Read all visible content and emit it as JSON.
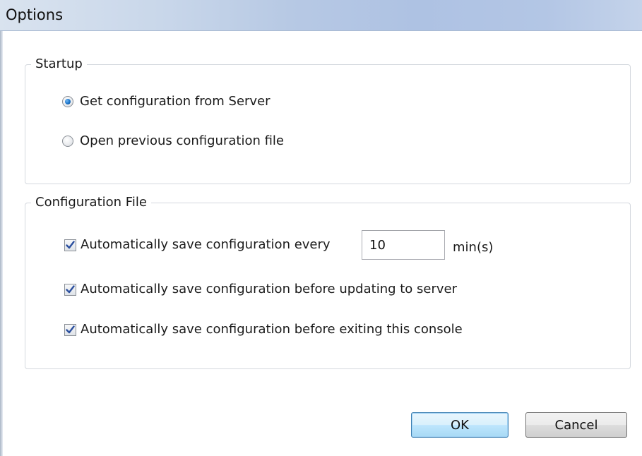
{
  "window": {
    "title": "Options"
  },
  "startup": {
    "legend": "Startup",
    "options": [
      {
        "label": "Get configuration from Server",
        "selected": true
      },
      {
        "label": "Open previous configuration file",
        "selected": false
      }
    ]
  },
  "config_file": {
    "legend": "Configuration File",
    "auto_save_every": {
      "label": "Automatically save configuration every",
      "checked": true,
      "minutes_value": "10",
      "unit": "min(s)"
    },
    "before_update": {
      "label": "Automatically save configuration before updating to server",
      "checked": true
    },
    "before_exit": {
      "label": "Automatically save configuration before exiting this console",
      "checked": true
    }
  },
  "buttons": {
    "ok_label": "OK",
    "cancel_label": "Cancel"
  },
  "colors": {
    "titlebar_accent": "#aec2e3",
    "radio_selected": "#1a73c9",
    "check_mark": "#2b4f9e",
    "ok_border": "#3c7fb1"
  }
}
